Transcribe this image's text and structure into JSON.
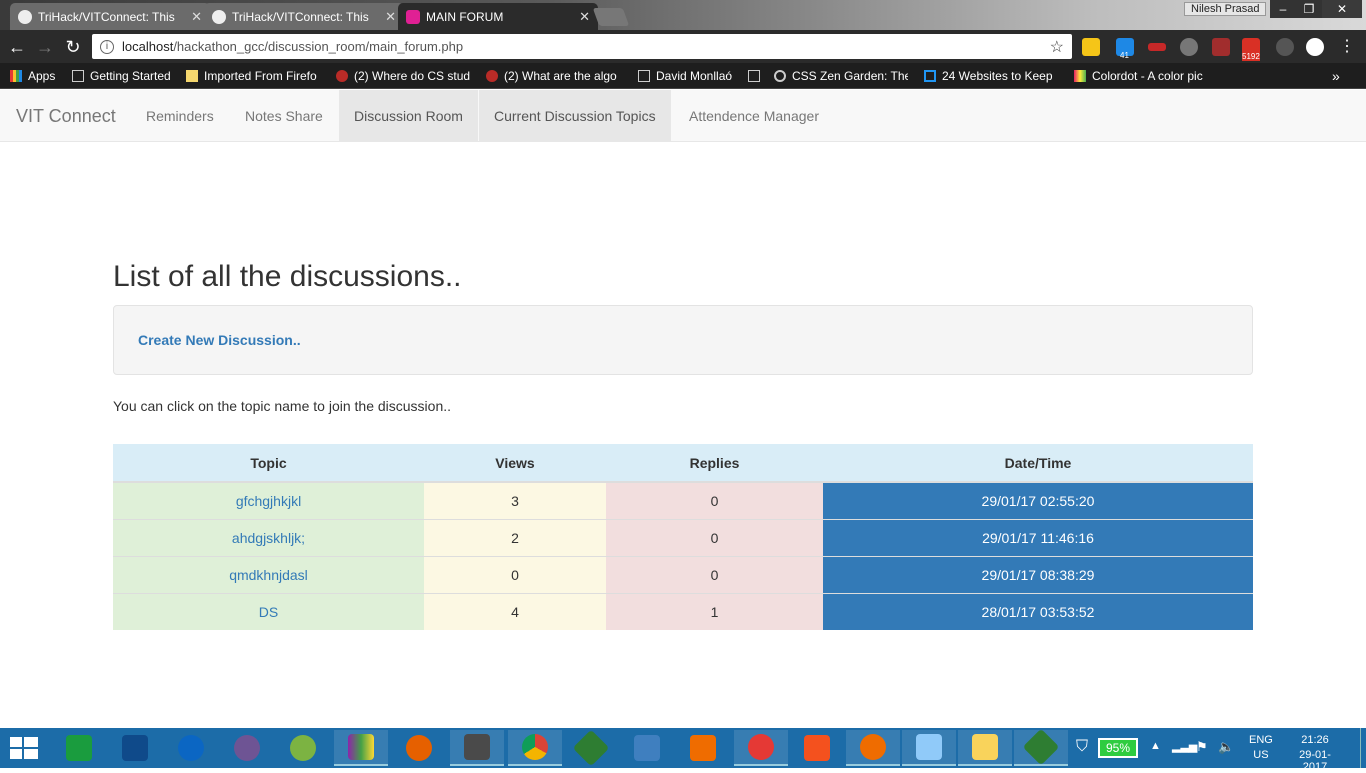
{
  "browser": {
    "tabs": [
      {
        "title": "TriHack/VITConnect: This",
        "active": false
      },
      {
        "title": "TriHack/VITConnect: This",
        "active": false
      },
      {
        "title": "MAIN FORUM",
        "active": true
      }
    ],
    "profile_name": "Nilesh Prasad",
    "url_host": "localhost",
    "url_path": "/hackathon_gcc/discussion_room/main_forum.php",
    "bookmarks": [
      "Apps",
      "Getting Started",
      "Imported From Firefo",
      "(2) Where do CS stud",
      "(2) What are the algo",
      "David Monllaó",
      "",
      "CSS Zen Garden: The",
      "24 Websites to Keep",
      "Colordot - A color pic"
    ],
    "ext_badges": {
      "gmail": "5192",
      "chat": "41"
    }
  },
  "site": {
    "brand": "VIT Connect",
    "nav": [
      "Reminders",
      "Notes Share",
      "Discussion Room",
      "Current Discussion Topics",
      "Attendence Manager"
    ],
    "heading": "List of all the discussions..",
    "create_link": "Create New Discussion..",
    "hint": "You can click on the topic name to join the discussion..",
    "table": {
      "headers": [
        "Topic",
        "Views",
        "Replies",
        "Date/Time"
      ],
      "rows": [
        {
          "topic": "gfchgjhkjkl",
          "views": "3",
          "replies": "0",
          "datetime": "29/01/17 02:55:20"
        },
        {
          "topic": "ahdgjskhljk;",
          "views": "2",
          "replies": "0",
          "datetime": "29/01/17 11:46:16"
        },
        {
          "topic": "qmdkhnjdasl",
          "views": "0",
          "replies": "0",
          "datetime": "29/01/17 08:38:29"
        },
        {
          "topic": "DS",
          "views": "4",
          "replies": "1",
          "datetime": "28/01/17 03:53:52"
        }
      ]
    }
  },
  "taskbar": {
    "battery": "95%",
    "lang": "ENG",
    "region": "US",
    "time": "21:26",
    "date": "29-01-2017"
  },
  "colors": {
    "link": "#337ab7",
    "success": "#dff0d8",
    "warning": "#fcf8e3",
    "danger": "#f2dede",
    "info": "#d9edf7",
    "taskbar": "#1c6ca8"
  }
}
